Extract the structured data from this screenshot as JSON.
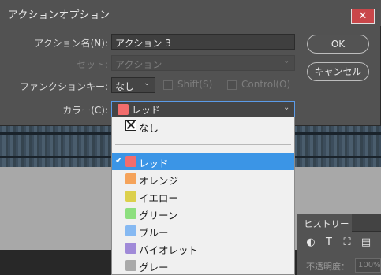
{
  "dialog": {
    "title": "アクションオプション",
    "close_glyph": "✕",
    "action_name_label": "アクション名(N):",
    "action_name_value": "アクション 3",
    "set_label": "セット:",
    "set_value": "アクション",
    "function_key_label": "ファンクションキー:",
    "function_key_value": "なし",
    "shift_label": "Shift(S)",
    "control_label": "Control(O)",
    "color_label": "カラー(C):",
    "color_value": "レッド",
    "color_value_hex": "#f26d6d",
    "ok_label": "OK",
    "cancel_label": "キャンセル"
  },
  "color_options": [
    {
      "label": "なし",
      "icon": "x-box-icon"
    },
    {
      "label": "レッド",
      "color": "#f26d6d",
      "selected": true
    },
    {
      "label": "オレンジ",
      "color": "#f5a35a"
    },
    {
      "label": "イエロー",
      "color": "#dcd04c"
    },
    {
      "label": "グリーン",
      "color": "#8ddf7f"
    },
    {
      "label": "ブルー",
      "color": "#86b9f2"
    },
    {
      "label": "バイオレット",
      "color": "#a08ad8"
    },
    {
      "label": "グレー",
      "color": "#a9a9a9"
    }
  ],
  "history_panel": {
    "tab_label": "ヒストリー",
    "opacity_label": "不透明度：",
    "opacity_value": "100%",
    "tools": [
      "contrast-icon",
      "type-icon",
      "transform-icon",
      "page-icon"
    ]
  },
  "colors": {
    "accent": "#3b95e6",
    "close_button": "#c9474a"
  }
}
